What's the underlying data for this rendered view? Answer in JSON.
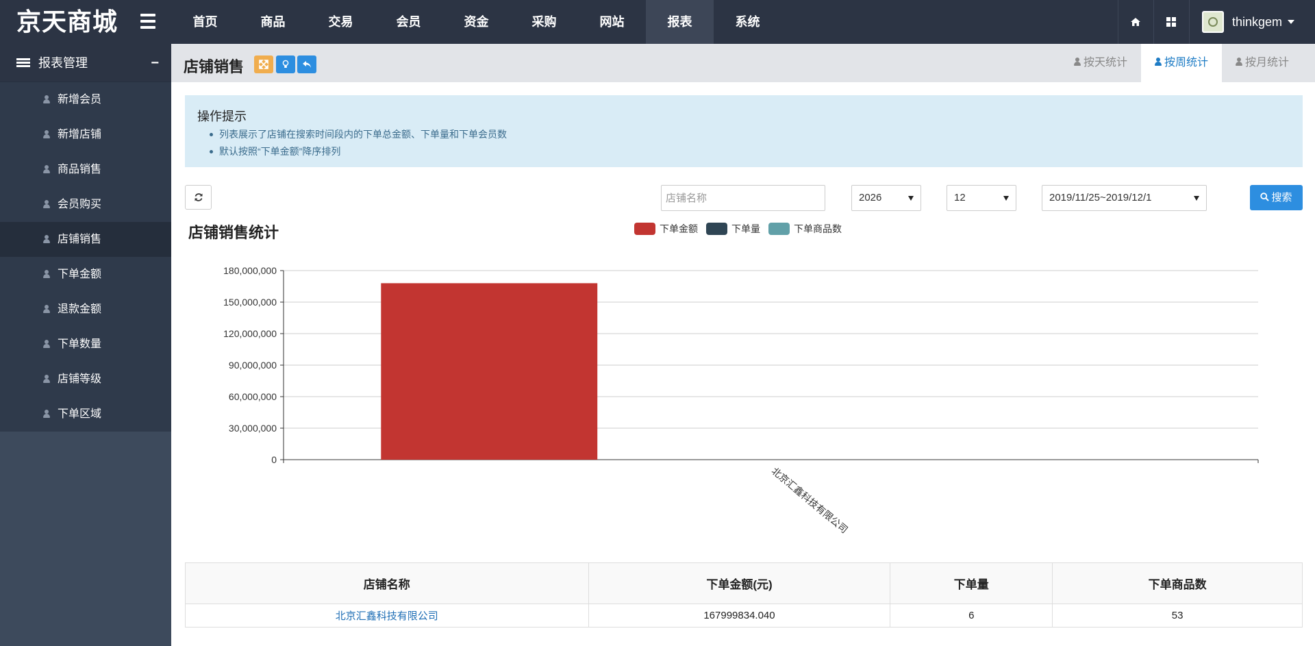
{
  "app": {
    "brand": "京天商城"
  },
  "nav": {
    "items": [
      {
        "label": "首页"
      },
      {
        "label": "商品"
      },
      {
        "label": "交易"
      },
      {
        "label": "会员"
      },
      {
        "label": "资金"
      },
      {
        "label": "采购"
      },
      {
        "label": "网站"
      },
      {
        "label": "报表",
        "active": true
      },
      {
        "label": "系统"
      }
    ],
    "user": {
      "name": "thinkgem"
    }
  },
  "sidebar": {
    "title": "报表管理",
    "collapse_symbol": "−",
    "items": [
      {
        "label": "新增会员"
      },
      {
        "label": "新增店铺"
      },
      {
        "label": "商品销售"
      },
      {
        "label": "会员购买"
      },
      {
        "label": "店铺销售",
        "active": true
      },
      {
        "label": "下单金额"
      },
      {
        "label": "退款金额"
      },
      {
        "label": "下单数量"
      },
      {
        "label": "店铺等级"
      },
      {
        "label": "下单区域"
      }
    ]
  },
  "page": {
    "title": "店铺销售",
    "tabs": [
      {
        "label": "按天统计"
      },
      {
        "label": "按周统计",
        "active": true
      },
      {
        "label": "按月统计"
      }
    ]
  },
  "tips": {
    "title": "操作提示",
    "items": [
      "列表展示了店铺在搜索时间段内的下单总金额、下单量和下单会员数",
      "默认按照“下单金额”降序排列"
    ]
  },
  "filters": {
    "shop_placeholder": "店铺名称",
    "year": "2026",
    "month": "12",
    "week": "2019/11/25~2019/12/1",
    "search_label": "搜索"
  },
  "colors": {
    "series1": "#c23531",
    "series2": "#2f4554",
    "series3": "#61a0a8",
    "accent": "#2d8ee0"
  },
  "chart_data": {
    "type": "bar",
    "title": "店铺销售统计",
    "categories": [
      "北京汇鑫科技有限公司"
    ],
    "series": [
      {
        "name": "下单金额",
        "values": [
          167999834.04
        ]
      },
      {
        "name": "下单量",
        "values": [
          6
        ]
      },
      {
        "name": "下单商品数",
        "values": [
          53
        ]
      }
    ],
    "ylim": [
      0,
      180000000
    ],
    "yticks": [
      "0",
      "30,000,000",
      "60,000,000",
      "90,000,000",
      "120,000,000",
      "150,000,000",
      "180,000,000"
    ],
    "grid": true,
    "legend": "top-center"
  },
  "table": {
    "headers": [
      "店铺名称",
      "下单金额(元)",
      "下单量",
      "下单商品数"
    ],
    "rows": [
      [
        "北京汇鑫科技有限公司",
        "167999834.040",
        "6",
        "53"
      ]
    ]
  }
}
